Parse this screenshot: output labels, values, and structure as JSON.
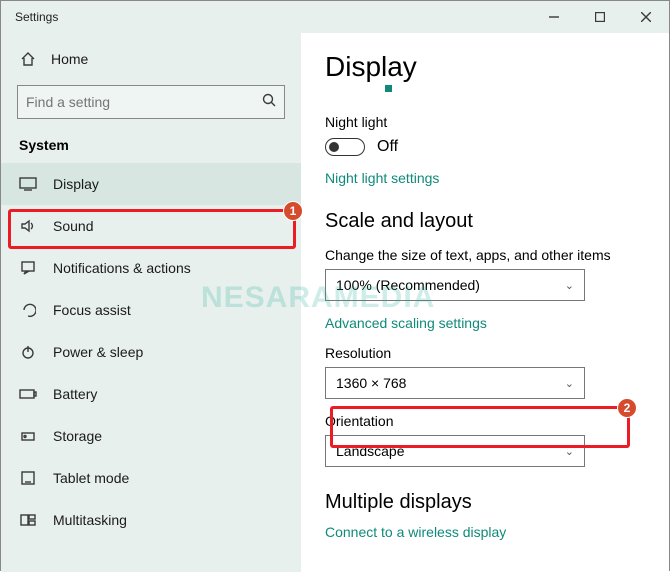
{
  "window": {
    "title": "Settings"
  },
  "sidebar": {
    "home": "Home",
    "search_placeholder": "Find a setting",
    "section": "System",
    "items": [
      {
        "label": "Display"
      },
      {
        "label": "Sound"
      },
      {
        "label": "Notifications & actions"
      },
      {
        "label": "Focus assist"
      },
      {
        "label": "Power & sleep"
      },
      {
        "label": "Battery"
      },
      {
        "label": "Storage"
      },
      {
        "label": "Tablet mode"
      },
      {
        "label": "Multitasking"
      }
    ]
  },
  "main": {
    "title": "Display",
    "night_light_label": "Night light",
    "night_light_state": "Off",
    "night_light_link": "Night light settings",
    "scale_heading": "Scale and layout",
    "scale_label": "Change the size of text, apps, and other items",
    "scale_value": "100% (Recommended)",
    "adv_scaling": "Advanced scaling settings",
    "res_label": "Resolution",
    "res_value": "1360 × 768",
    "orient_label": "Orientation",
    "orient_value": "Landscape",
    "multi_heading": "Multiple displays",
    "wireless_link": "Connect to a wireless display"
  },
  "annotations": {
    "badge1": "1",
    "badge2": "2"
  },
  "watermark": "NESARAMEDIA"
}
